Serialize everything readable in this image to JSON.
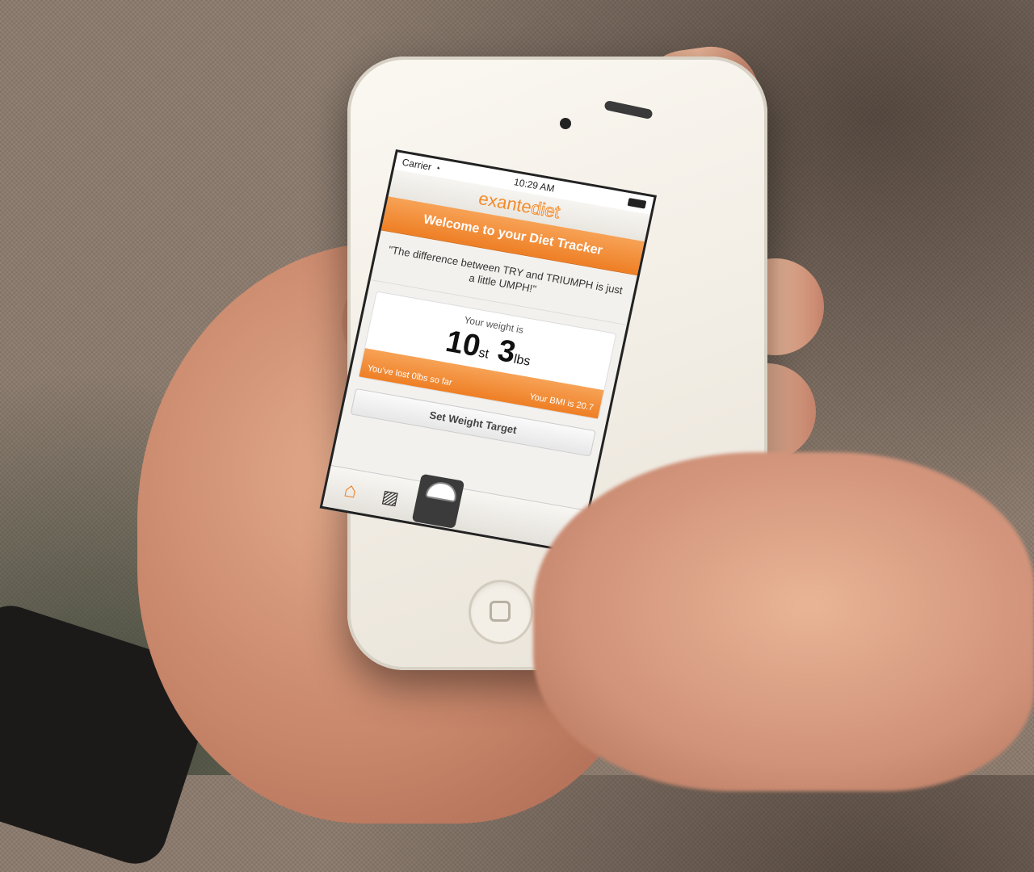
{
  "status_bar": {
    "carrier": "Carrier",
    "time": "10:29 AM"
  },
  "logo": {
    "part1": "exante",
    "part2": "diet"
  },
  "banner": {
    "title": "Welcome to your Diet Tracker"
  },
  "quote": {
    "text": "\"The difference between TRY and TRIUMPH is just a little UMPH!\""
  },
  "weight": {
    "label": "Your weight is",
    "stones": "10",
    "stones_unit": "st",
    "pounds": "3",
    "pounds_unit": "lbs",
    "lost_text": "You've lost 0lbs so far",
    "bmi_text": "Your BMI is 20.7"
  },
  "actions": {
    "set_target_label": "Set Weight Target"
  },
  "tabs": [
    {
      "icon": "home-icon",
      "active": true
    },
    {
      "icon": "chart-icon",
      "active": false
    },
    {
      "icon": "scale-icon",
      "active": false
    }
  ],
  "colors": {
    "accent": "#ef7f22",
    "banner_text": "#ffffff"
  }
}
